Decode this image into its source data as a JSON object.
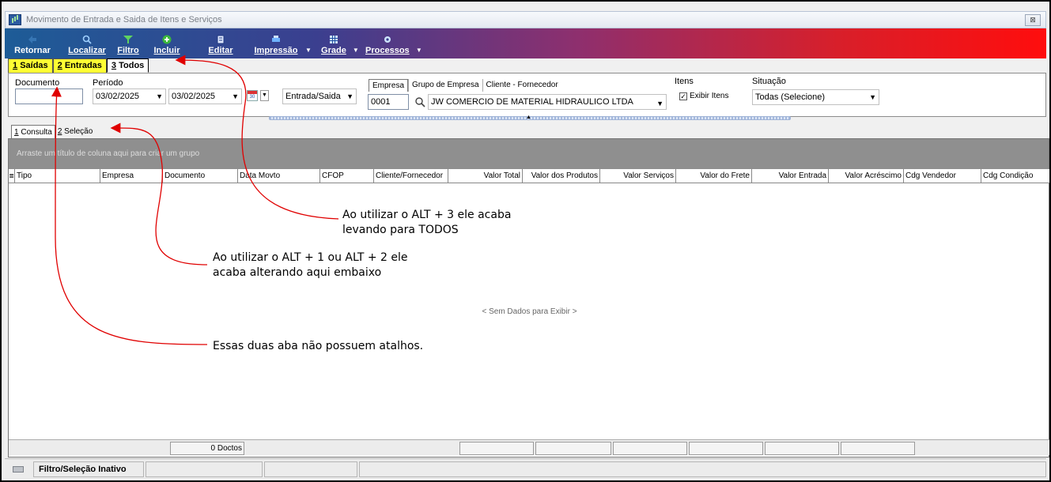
{
  "window": {
    "title": "Movimento de Entrada e Saida de Itens e Serviços",
    "close_label": "⊠"
  },
  "toolbar": {
    "items": [
      {
        "label": "Retornar",
        "icon": "back-icon",
        "dropdown": false
      },
      {
        "label": "Localizar",
        "icon": "search-icon",
        "dropdown": false
      },
      {
        "label": "Filtro",
        "icon": "funnel-icon",
        "dropdown": false
      },
      {
        "label": "Incluir",
        "icon": "plus-icon",
        "dropdown": false
      },
      {
        "label": "Editar",
        "icon": "edit-icon",
        "dropdown": false
      },
      {
        "label": "Impressão",
        "icon": "printer-icon",
        "dropdown": true
      },
      {
        "label": "Grade",
        "icon": "grid-icon",
        "dropdown": true
      },
      {
        "label": "Processos",
        "icon": "gear-icon",
        "dropdown": true
      }
    ]
  },
  "top_tabs": [
    {
      "key": "1",
      "label": "Saídas"
    },
    {
      "key": "2",
      "label": "Entradas"
    },
    {
      "key": "3",
      "label": "Todos"
    }
  ],
  "filters": {
    "documento_label": "Documento",
    "documento_value": "",
    "periodo_label": "Período",
    "date_from": "03/02/2025",
    "date_to": "03/02/2025",
    "direction_value": "Entrada/Saida",
    "empresa_tabs": [
      "Empresa",
      "Grupo de Empresa",
      "Cliente - Fornecedor"
    ],
    "empresa_code": "0001",
    "empresa_name": "JW COMERCIO DE MATERIAL HIDRAULICO LTDA",
    "itens_label": "Itens",
    "exibir_itens_label": "Exibir Itens",
    "exibir_itens_checked": true,
    "situacao_label": "Situação",
    "situacao_value": "Todas (Selecione)"
  },
  "lower_tabs": [
    {
      "key": "1",
      "label": "Consulta"
    },
    {
      "key": "2",
      "label": "Seleção"
    }
  ],
  "grid": {
    "group_hint": "Arraste um título de coluna aqui para criar um grupo",
    "columns": [
      "Tipo",
      "Empresa",
      "Documento",
      "Data Movto",
      "CFOP",
      "Cliente/Fornecedor",
      "Valor Total",
      "Valor dos Produtos",
      "Valor Serviços",
      "Valor do Frete",
      "Valor Entrada",
      "Valor Acréscimo",
      "Cdg Vendedor",
      "Cdg Condição"
    ],
    "no_data": "< Sem Dados para Exibir >",
    "footer_count": "0 Doctos"
  },
  "status": {
    "filter_state": "Filtro/Seleção Inativo"
  },
  "annotations": {
    "alt3_line1": "Ao utilizar o ALT + 3 ele acaba",
    "alt3_line2": "levando para TODOS",
    "alt12_line1": "Ao utilizar o ALT + 1 ou ALT + 2 ele",
    "alt12_line2": "acaba alterando aqui embaixo",
    "no_shortcut": "Essas duas aba não possuem atalhos.",
    "arrow_color": "#e00000"
  }
}
